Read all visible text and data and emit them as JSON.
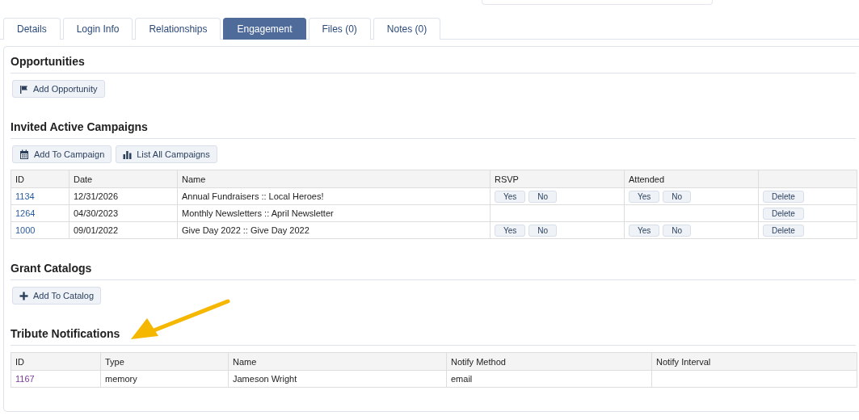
{
  "tabs": [
    {
      "label": "Details",
      "selected": false
    },
    {
      "label": "Login Info",
      "selected": false
    },
    {
      "label": "Relationships",
      "selected": false
    },
    {
      "label": "Engagement",
      "selected": true
    },
    {
      "label": "Files (0)",
      "selected": false
    },
    {
      "label": "Notes (0)",
      "selected": false
    }
  ],
  "sections": [
    {
      "title": "Opportunities",
      "buttons": [
        {
          "label": "Add Opportunity"
        }
      ]
    },
    {
      "title": "Invited Active Campaigns",
      "buttons": [
        {
          "label": "Add To Campaign"
        },
        {
          "label": "List All Campaigns"
        }
      ],
      "table": {
        "columns": [
          "ID",
          "Date",
          "Name",
          "RSVP",
          "Attended"
        ],
        "rows": [
          {
            "visited": false,
            "cells": [
              "1134",
              "12/31/2026",
              "Annual Fundraisers :: Local Heroes!"
            ],
            "rsvp": [
              "Yes",
              "No"
            ],
            "attended": [
              "Yes",
              "No"
            ],
            "action": "Delete"
          },
          {
            "visited": false,
            "cells": [
              "1264",
              "04/30/2023",
              "Monthly Newsletters :: April Newsletter"
            ],
            "action": "Delete"
          },
          {
            "visited": false,
            "cells": [
              "1000",
              "09/01/2022",
              "Give Day 2022 :: Give Day 2022"
            ],
            "rsvp": [
              "Yes",
              "No"
            ],
            "attended": [
              "Yes",
              "No"
            ],
            "action": "Delete"
          }
        ]
      }
    },
    {
      "title": "Grant Catalogs",
      "buttons": [
        {
          "label": "Add To Catalog"
        }
      ]
    },
    {
      "title": "Tribute Notifications",
      "table": {
        "columns": [
          "ID",
          "Type",
          "Name",
          "Notify Method",
          "Notify Interval"
        ],
        "rows": [
          {
            "visited": true,
            "cells": [
              "1167",
              "memory",
              "Jameson Wright",
              "email"
            ]
          }
        ]
      }
    }
  ]
}
